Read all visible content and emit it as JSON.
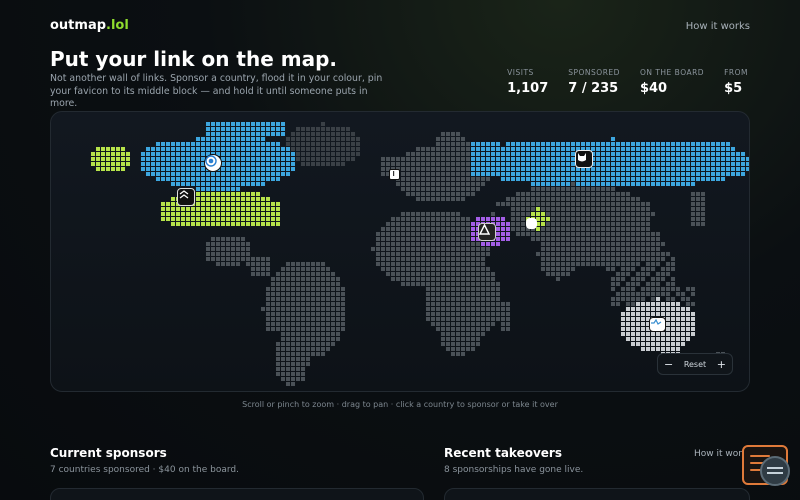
{
  "header": {
    "brand_main": "outmap",
    "brand_tld": ".lol",
    "nav_how": "How it works"
  },
  "hero": {
    "title": "Put your link on the map.",
    "subtitle": "Not another wall of links. Sponsor a country, flood it in your colour, pin your favicon to its middle block — and hold it until someone puts in more."
  },
  "stats": [
    {
      "label": "VISITS",
      "value": "1,107"
    },
    {
      "label": "SPONSORED",
      "value": "7 / 235"
    },
    {
      "label": "ON THE BOARD",
      "value": "$40"
    },
    {
      "label": "FROM",
      "value": "$5"
    }
  ],
  "map": {
    "reset_label": "Reset",
    "zoom_out": "−",
    "zoom_in": "+",
    "hint": "Scroll or pinch to zoom · drag to pan · click a country to sponsor or take it over",
    "colors": {
      "land": "#4a5157",
      "land_dim": "#3a4046",
      "blue": "#3da6df",
      "green": "#b6e34a",
      "purple": "#a35ee6",
      "light": "#c9cdd1",
      "background": "#0f141a"
    },
    "pins": [
      {
        "country": "Canada",
        "icon": "target-icon"
      },
      {
        "country": "United States",
        "icon": "chevrons-icon"
      },
      {
        "country": "Russia",
        "icon": "cat-icon"
      },
      {
        "country": "Switzerland",
        "icon": "info-icon"
      },
      {
        "country": "Saudi Arabia",
        "icon": "triangle-icon"
      },
      {
        "country": "Pakistan",
        "icon": "blank-icon"
      },
      {
        "country": "Australia",
        "icon": "wave-icon"
      }
    ]
  },
  "sponsors": {
    "title": "Current sponsors",
    "subtitle": "7 countries sponsored · $40 on the board."
  },
  "takeovers": {
    "title": "Recent takeovers",
    "subtitle": "8 sponsorships have gone live.",
    "link": "How it works"
  }
}
